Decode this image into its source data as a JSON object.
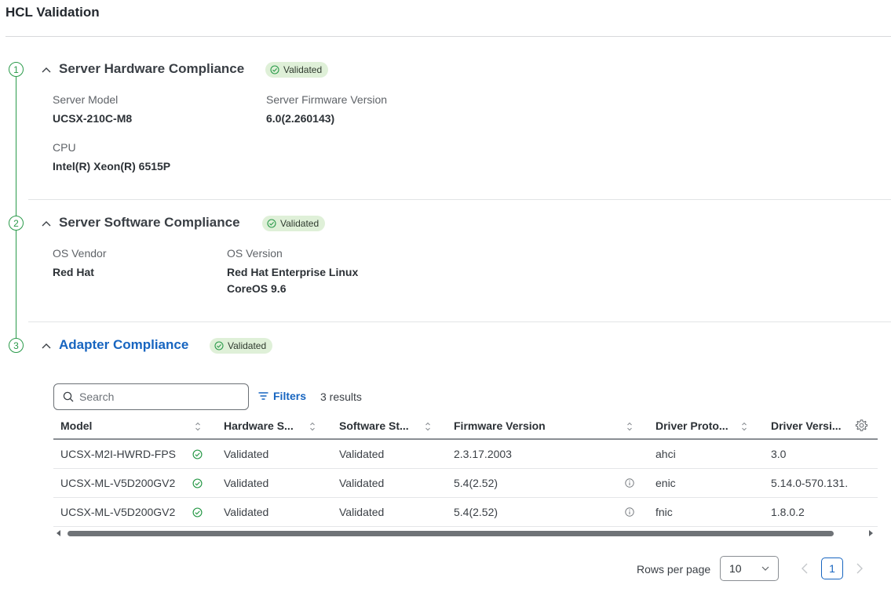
{
  "page": {
    "title": "HCL Validation"
  },
  "sections": [
    {
      "number": "1",
      "title": "Server Hardware Compliance",
      "status": "Validated",
      "fields": [
        {
          "label": "Server Model",
          "value": "UCSX-210C-M8"
        },
        {
          "label": "Server Firmware Version",
          "value": "6.0(2.260143)"
        },
        {
          "label": "CPU",
          "value": "Intel(R) Xeon(R) 6515P"
        }
      ]
    },
    {
      "number": "2",
      "title": "Server Software Compliance",
      "status": "Validated",
      "fields": [
        {
          "label": "OS Vendor",
          "value": "Red Hat"
        },
        {
          "label": "OS Version",
          "value_line1": "Red Hat Enterprise Linux",
          "value_line2": "CoreOS 9.6"
        }
      ]
    },
    {
      "number": "3",
      "title": "Adapter Compliance",
      "status": "Validated"
    }
  ],
  "table_toolbar": {
    "search_placeholder": "Search",
    "filters_label": "Filters",
    "results_text": "3 results"
  },
  "table": {
    "columns": [
      "Model",
      "Hardware S...",
      "Software St...",
      "Firmware Version",
      "Driver Proto...",
      "Driver Versi..."
    ],
    "rows": [
      {
        "model": "UCSX-M2I-HWRD-FPS",
        "hardware": "Validated",
        "software": "Validated",
        "firmware": "2.3.17.2003",
        "has_info": false,
        "driver_protocol": "ahci",
        "driver_version": "3.0"
      },
      {
        "model": "UCSX-ML-V5D200GV2",
        "hardware": "Validated",
        "software": "Validated",
        "firmware": "5.4(2.52)",
        "has_info": true,
        "driver_protocol": "enic",
        "driver_version": "5.14.0-570.131."
      },
      {
        "model": "UCSX-ML-V5D200GV2",
        "hardware": "Validated",
        "software": "Validated",
        "firmware": "5.4(2.52)",
        "has_info": true,
        "driver_protocol": "fnic",
        "driver_version": "1.8.0.2"
      }
    ]
  },
  "pagination": {
    "rows_per_page_label": "Rows per page",
    "rows_per_page_value": "10",
    "current_page": "1"
  },
  "colors": {
    "accent": "#1765c0",
    "success": "#2a9a4a",
    "badge_bg": "#dff0d8"
  }
}
